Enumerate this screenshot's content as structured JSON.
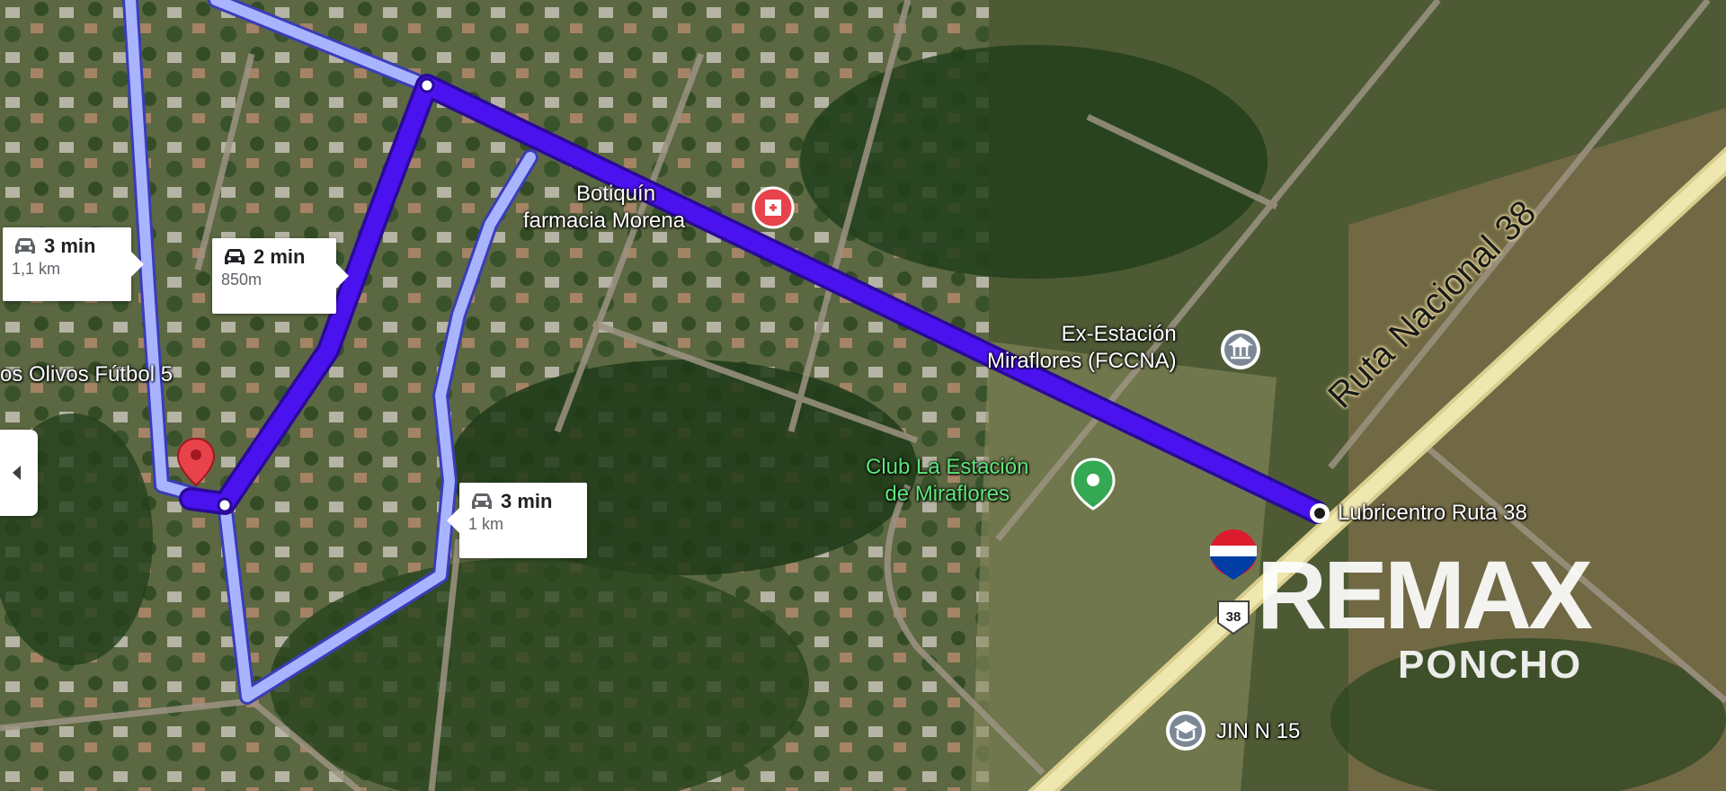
{
  "map": {
    "road_label": "Ruta Nacional 38",
    "road_shield_number": "38",
    "pois": [
      {
        "id": "botiquin",
        "lines": [
          "Botiquín",
          "farmacia Morena"
        ],
        "icon": "pharmacy-pin-icon",
        "color": "#e8434b"
      },
      {
        "id": "ex-estacion",
        "lines": [
          "Ex-Estación",
          "Miraflores (FCCNA)"
        ],
        "icon": "museum-pin-icon",
        "color": "#ffffff"
      },
      {
        "id": "club",
        "lines": [
          "Club La Estación",
          "de Miraflores"
        ],
        "icon": "park-pin-icon",
        "color": "#34a853"
      },
      {
        "id": "lubricentro",
        "lines": [
          "Lubricentro Ruta 38"
        ],
        "icon": "destination-circle-icon",
        "color": "#ffffff"
      },
      {
        "id": "jin",
        "lines": [
          "JIN N 15"
        ],
        "icon": "school-pin-icon",
        "color": "#ffffff"
      },
      {
        "id": "olivos",
        "lines": [
          "os Olivos Fútbol 5"
        ],
        "icon": "",
        "color": "#ffffff"
      }
    ],
    "routes": [
      {
        "id": "main",
        "time": "2 min",
        "distance": "850m",
        "color": "#4b12f0"
      },
      {
        "id": "alt-west",
        "time": "3 min",
        "distance": "1,1 km",
        "color": "#a9b4ff"
      },
      {
        "id": "alt-east",
        "time": "3 min",
        "distance": "1 km",
        "color": "#a9b4ff"
      }
    ]
  },
  "watermark": {
    "brand": "REMAX",
    "office": "PONCHO",
    "balloon_colors": [
      "#dc1c2e",
      "#ffffff",
      "#003da5"
    ]
  },
  "controls": {
    "collapse_icon": "chevron-left-icon"
  }
}
